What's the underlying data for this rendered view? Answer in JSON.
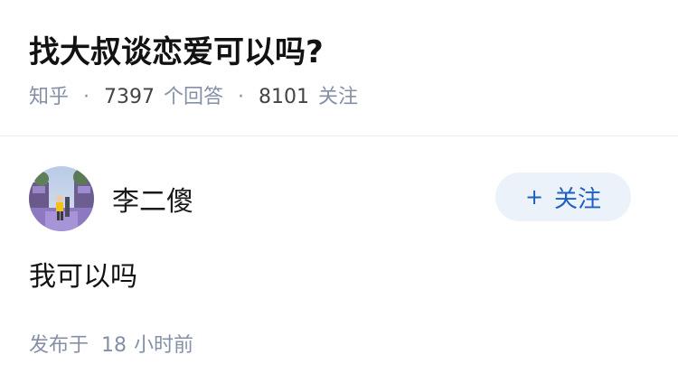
{
  "question": {
    "title": "找大叔谈恋爱可以吗?",
    "site_label": "知乎",
    "separator": "·",
    "answer_count": "7397",
    "answer_count_label": "个回答",
    "follower_count": "8101",
    "follower_count_label": "关注"
  },
  "answer": {
    "author_name": "李二傻",
    "follow_plus": "+",
    "follow_label": "关注",
    "content": "我可以吗",
    "published_prefix": "发布于",
    "published_num": "18",
    "published_unit": "小时前"
  },
  "colors": {
    "meta_gray": "#8590a6",
    "follow_bg": "#ebf2fa",
    "follow_text": "#1f5fbf"
  },
  "icons": {
    "avatar": "avatar-photo"
  }
}
